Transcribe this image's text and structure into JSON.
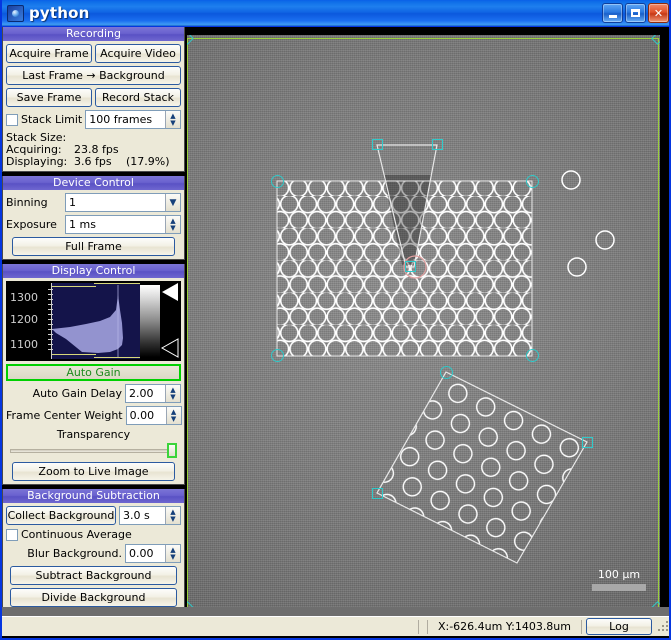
{
  "window": {
    "title": "python",
    "icon": "python-app-icon",
    "minimize_label": "_",
    "maximize_label": "□",
    "close_label": "✕"
  },
  "recording": {
    "header": "Recording",
    "acquire_frame": "Acquire Frame",
    "acquire_video": "Acquire Video",
    "last_frame_background": "Last Frame → Background",
    "save_frame": "Save Frame",
    "record_stack": "Record Stack",
    "stack_limit_label": "Stack Limit",
    "stack_limit_value": "100 frames",
    "stack_size_label": "Stack Size:",
    "acquiring_label": "Acquiring:",
    "acquiring_value": "23.8 fps",
    "displaying_label": "Displaying:",
    "displaying_value": "3.6 fps",
    "displaying_percent": "(17.9%)"
  },
  "device_control": {
    "header": "Device Control",
    "binning_label": "Binning",
    "binning_value": "1",
    "exposure_label": "Exposure",
    "exposure_value": "1 ms",
    "full_frame": "Full Frame"
  },
  "display_control": {
    "header": "Display Control",
    "histogram_ticks": [
      "1300",
      "1200",
      "1100"
    ],
    "auto_gain": "Auto Gain",
    "auto_gain_delay_label": "Auto Gain Delay",
    "auto_gain_delay_value": "2.00",
    "frame_center_weight_label": "Frame Center Weight",
    "frame_center_weight_value": "0.00",
    "transparency_label": "Transparency",
    "zoom_to_live_image": "Zoom to Live Image"
  },
  "background_subtraction": {
    "header": "Background Subtraction",
    "collect_background": "Collect Background",
    "collect_background_time": "3.0 s",
    "continuous_average": "Continuous Average",
    "blur_background_label": "Blur Background.",
    "blur_background_value": "0.00",
    "subtract_background": "Subtract Background",
    "divide_background": "Divide Background"
  },
  "viewport": {
    "scale_bar_label": "100 µm",
    "roi_color": "#9ad13a",
    "handle_color": "#2ec9c9",
    "overlay_color": "#ffffff"
  },
  "statusbar": {
    "coordinates": "X:-626.4um Y:1403.8um",
    "log_button": "Log"
  }
}
